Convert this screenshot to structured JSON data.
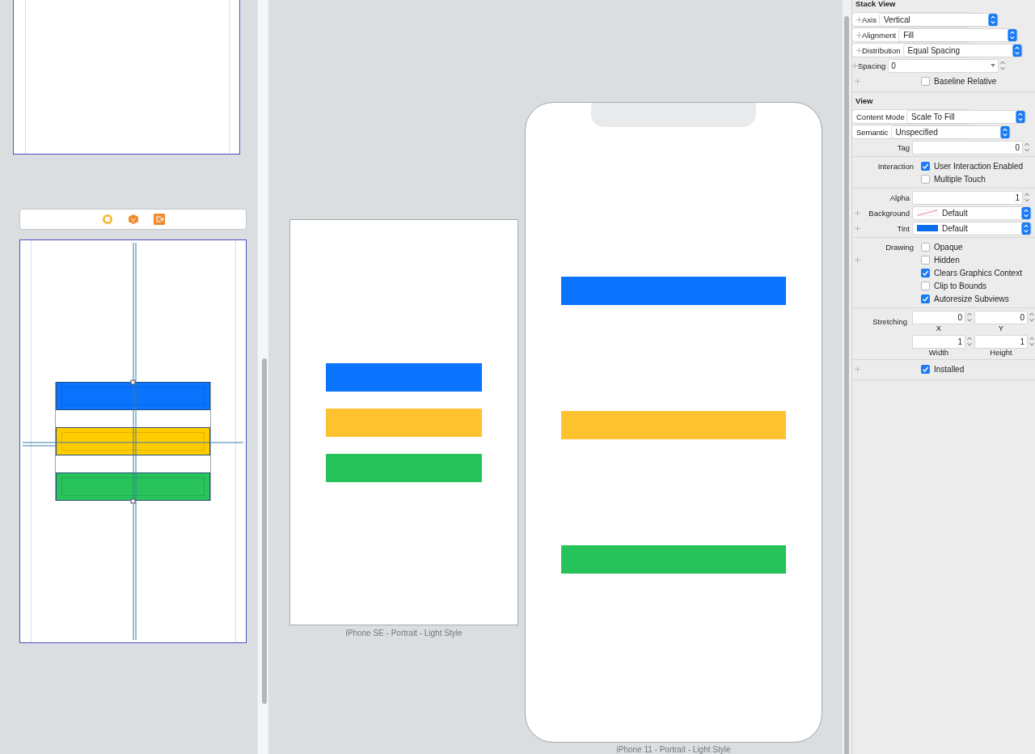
{
  "storyboard": {
    "scene_bar_icons": [
      {
        "kind": "circle"
      },
      {
        "kind": "cube"
      },
      {
        "kind": "exit"
      }
    ],
    "stack_bars": [
      {
        "color": "#0a74ff"
      },
      {
        "color": "#ffcc00"
      },
      {
        "color": "#28c35a"
      }
    ]
  },
  "devices": [
    {
      "kind": "rect",
      "label": "iPhone SE - Portrait - Light Style",
      "bars": [
        {
          "color": "#0a74ff"
        },
        {
          "color": "#ffc22f"
        },
        {
          "color": "#26c35a"
        }
      ]
    },
    {
      "kind": "notched",
      "label": "iPhone 11 - Portrait - Light Style",
      "bars": [
        {
          "color": "#0a74ff"
        },
        {
          "color": "#ffc22f"
        },
        {
          "color": "#26c35a"
        }
      ]
    }
  ],
  "inspector": {
    "sections": [
      {
        "title": "Stack View",
        "groups": [
          [
            {
              "kind": "popup",
              "label": "Axis",
              "value": "Vertical",
              "plus": true
            },
            {
              "kind": "popup",
              "label": "Alignment",
              "value": "Fill",
              "plus": true
            },
            {
              "kind": "popup",
              "label": "Distribution",
              "value": "Equal Spacing",
              "plus": true
            },
            {
              "kind": "combo",
              "label": "Spacing",
              "value": "0",
              "plus": true
            },
            {
              "kind": "check",
              "text": "Baseline Relative",
              "checked": false,
              "plus": true
            }
          ]
        ]
      },
      {
        "title": "View",
        "groups": [
          [
            {
              "kind": "popup",
              "label": "Content Mode",
              "value": "Scale To Fill",
              "plus": false
            },
            {
              "kind": "popup",
              "label": "Semantic",
              "value": "Unspecified",
              "plus": false
            },
            {
              "kind": "number",
              "label": "Tag",
              "value": "0",
              "plus": false
            }
          ],
          [
            {
              "kind": "check",
              "label": "Interaction",
              "text": "User Interaction Enabled",
              "checked": true,
              "plus": false
            },
            {
              "kind": "check",
              "text": "Multiple Touch",
              "checked": false,
              "plus": false
            }
          ],
          [
            {
              "kind": "number",
              "label": "Alpha",
              "value": "1",
              "plus": false
            },
            {
              "kind": "color",
              "label": "Background",
              "value": "Default",
              "plus": true
            },
            {
              "kind": "color",
              "label": "Tint",
              "value": "Default",
              "color": "#0a6cf0",
              "plus": true
            }
          ],
          [
            {
              "kind": "check",
              "label": "Drawing",
              "text": "Opaque",
              "checked": false,
              "plus": false
            },
            {
              "kind": "check",
              "text": "Hidden",
              "checked": false,
              "plus": true
            },
            {
              "kind": "check",
              "text": "Clears Graphics Context",
              "checked": true,
              "plus": false
            },
            {
              "kind": "check",
              "text": "Clip to Bounds",
              "checked": false,
              "plus": false
            },
            {
              "kind": "check",
              "text": "Autoresize Subviews",
              "checked": true,
              "plus": false
            }
          ],
          [
            {
              "kind": "pair",
              "label": "Stretching",
              "fields": [
                {
                  "value": "0",
                  "caption": "X"
                },
                {
                  "value": "0",
                  "caption": "Y"
                }
              ],
              "plus": false
            },
            {
              "kind": "pair",
              "fields": [
                {
                  "value": "1",
                  "caption": "Width"
                },
                {
                  "value": "1",
                  "caption": "Height"
                }
              ],
              "plus": false
            }
          ],
          [
            {
              "kind": "check",
              "text": "Installed",
              "checked": true,
              "plus": true
            }
          ]
        ]
      }
    ]
  }
}
